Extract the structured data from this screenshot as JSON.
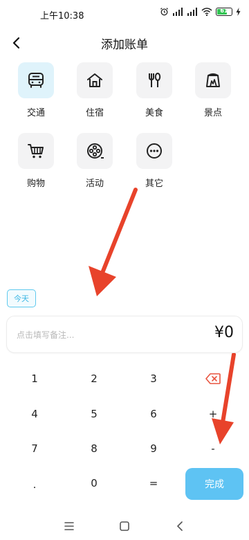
{
  "status_bar": {
    "time": "上午10:38",
    "battery": "61",
    "icons": [
      "alarm-icon",
      "signal-icon",
      "signal-icon",
      "wifi-icon",
      "battery-icon",
      "charging-icon"
    ]
  },
  "header": {
    "title": "添加账单",
    "back_icon": "chevron-left-icon"
  },
  "categories": [
    {
      "label": "交通",
      "icon": "bus-icon",
      "active": true
    },
    {
      "label": "住宿",
      "icon": "house-icon",
      "active": false
    },
    {
      "label": "美食",
      "icon": "utensils-icon",
      "active": false
    },
    {
      "label": "景点",
      "icon": "scenic-icon",
      "active": false
    },
    {
      "label": "购物",
      "icon": "cart-icon",
      "active": false
    },
    {
      "label": "活动",
      "icon": "film-reel-icon",
      "active": false
    },
    {
      "label": "其它",
      "icon": "more-dots-icon",
      "active": false
    }
  ],
  "date_chip": "今天",
  "note": {
    "placeholder": "点击填写备注...",
    "value": ""
  },
  "amount": "¥0",
  "keypad": {
    "rows": [
      [
        "1",
        "2",
        "3",
        "⌫"
      ],
      [
        "4",
        "5",
        "6",
        "+"
      ],
      [
        "7",
        "8",
        "9",
        "-"
      ],
      [
        ".",
        "0",
        "="
      ]
    ],
    "done_label": "完成"
  },
  "colors": {
    "accent": "#5ec3f3",
    "active_tile": "#dff3fb",
    "arrow": "#e8432b",
    "delete": "#e8543f"
  },
  "nav_bar": {
    "icons": [
      "menu-icon",
      "home-square-icon",
      "back-triangle-icon"
    ]
  }
}
